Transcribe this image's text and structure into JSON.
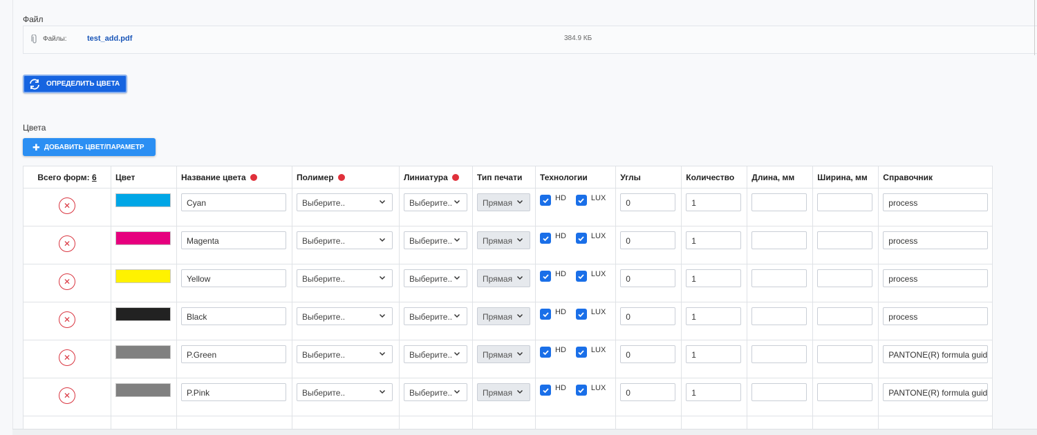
{
  "file_section": {
    "label": "Файл",
    "files_label": "Файлы:",
    "file_name": "test_add.pdf",
    "file_size": "384.9 КБ"
  },
  "detect_button": {
    "label": "ОПРЕДЕЛИТЬ ЦВЕТА"
  },
  "colors_section": {
    "label": "Цвета"
  },
  "add_button": {
    "label": "ДОБАВИТЬ ЦВЕТ/ПАРАМЕТР"
  },
  "table": {
    "headers": {
      "total_forms": "Всего форм:",
      "total_forms_count": "6",
      "color": "Цвет",
      "color_name": "Название цвета",
      "polymer": "Полимер",
      "lineature": "Линиатура",
      "print_type": "Тип печати",
      "technologies": "Технологии",
      "angles": "Углы",
      "quantity": "Количество",
      "length": "Длина, мм",
      "width": "Ширина, мм",
      "reference": "Справочник"
    },
    "rows": [
      {
        "swatch": "#00a6e6",
        "name": "Cyan",
        "polymer": "Выберите..",
        "lineature": "Выберите..",
        "print_type": "Прямая",
        "hd": "HD",
        "lux": "LUX",
        "angle": "0",
        "quantity": "1",
        "length": "",
        "width": "",
        "reference": "process"
      },
      {
        "swatch": "#e6007e",
        "name": "Magenta",
        "polymer": "Выберите..",
        "lineature": "Выберите..",
        "print_type": "Прямая",
        "hd": "HD",
        "lux": "LUX",
        "angle": "0",
        "quantity": "1",
        "length": "",
        "width": "",
        "reference": "process"
      },
      {
        "swatch": "#fff200",
        "name": "Yellow",
        "polymer": "Выберите..",
        "lineature": "Выберите..",
        "print_type": "Прямая",
        "hd": "HD",
        "lux": "LUX",
        "angle": "0",
        "quantity": "1",
        "length": "",
        "width": "",
        "reference": "process"
      },
      {
        "swatch": "#222222",
        "name": "Black",
        "polymer": "Выберите..",
        "lineature": "Выберите..",
        "print_type": "Прямая",
        "hd": "HD",
        "lux": "LUX",
        "angle": "0",
        "quantity": "1",
        "length": "",
        "width": "",
        "reference": "process"
      },
      {
        "swatch": "#808080",
        "name": "P.Green",
        "polymer": "Выберите..",
        "lineature": "Выберите..",
        "print_type": "Прямая",
        "hd": "HD",
        "lux": "LUX",
        "angle": "0",
        "quantity": "1",
        "length": "",
        "width": "",
        "reference": "PANTONE(R) formula guide"
      },
      {
        "swatch": "#808080",
        "name": "P.Pink",
        "polymer": "Выберите..",
        "lineature": "Выберите..",
        "print_type": "Прямая",
        "hd": "HD",
        "lux": "LUX",
        "angle": "0",
        "quantity": "1",
        "length": "",
        "width": "",
        "reference": "PANTONE(R) formula guide"
      }
    ]
  }
}
